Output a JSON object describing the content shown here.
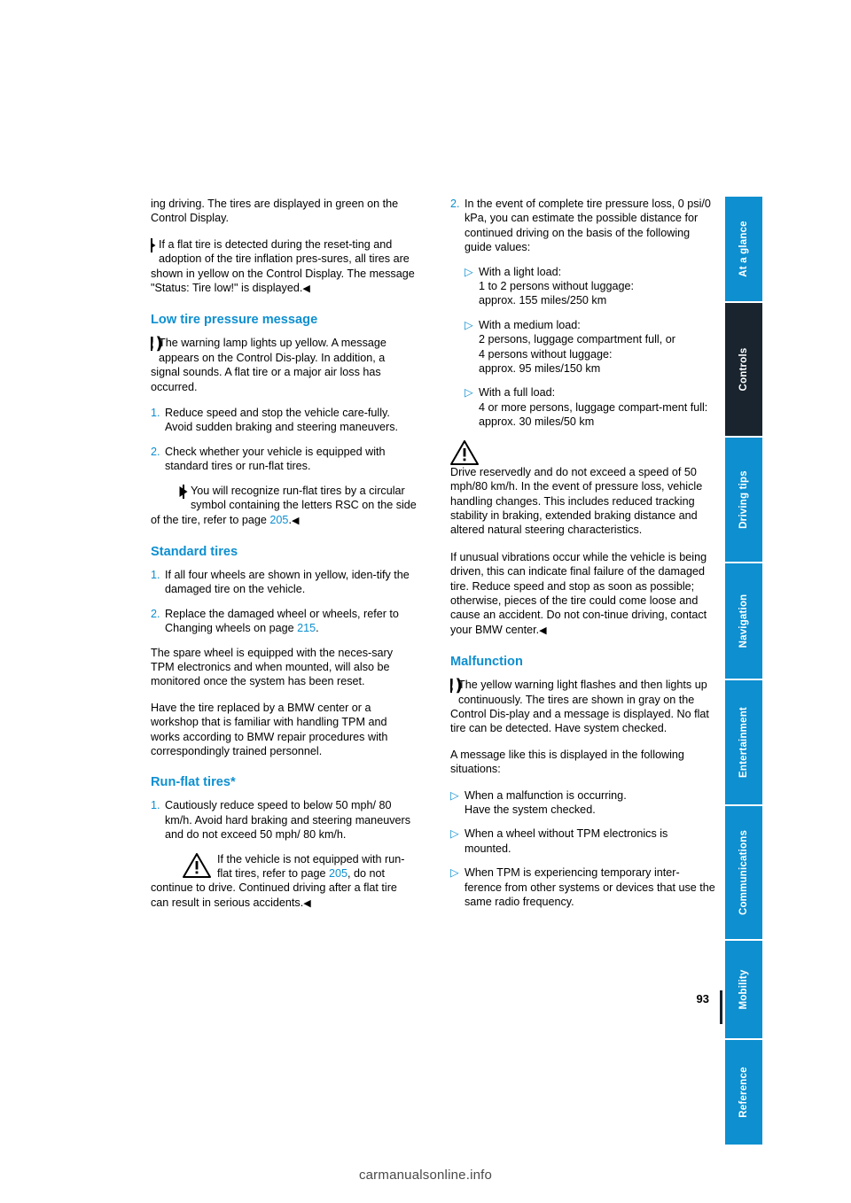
{
  "document": {
    "page_number": "93",
    "footer_brand": "carmanualsonline.info"
  },
  "tabs": [
    {
      "label": "At a glance",
      "style": "blue"
    },
    {
      "label": "Controls",
      "style": "dark"
    },
    {
      "label": "Driving tips",
      "style": "blue"
    },
    {
      "label": "Navigation",
      "style": "blue"
    },
    {
      "label": "Entertainment",
      "style": "blue"
    },
    {
      "label": "Communications",
      "style": "blue"
    },
    {
      "label": "Mobility",
      "style": "blue"
    },
    {
      "label": "Reference",
      "style": "blue"
    }
  ],
  "left_column": {
    "intro_para": "ing driving. The tires are displayed in green on the Control Display.",
    "note_reset": {
      "icon": "play-triangle-icon",
      "text_part1": "If a flat tire is detected during the reset-ting and adoption of the tire inflation pres-sures, all tires are shown in yellow on the Control Display. The message \"Status: Tire low!\" is displayed.",
      "end_mark": "◀"
    },
    "low_pressure": {
      "heading": "Low tire pressure message",
      "icon": "flat-tire-warning-icon",
      "para": "The warning lamp lights up yellow. A message appears on the Control Dis-play. In addition, a signal sounds. A flat tire or a major air loss has occurred.",
      "steps": [
        {
          "num": "1.",
          "text": "Reduce speed and stop the vehicle care-fully. Avoid sudden braking and steering maneuvers."
        },
        {
          "num": "2.",
          "text": "Check whether your vehicle is equipped with standard tires or run-flat tires."
        }
      ],
      "note_rsc": {
        "icon": "play-triangle-icon",
        "text_before": "You will recognize run-flat tires by a circular symbol containing the letters RSC on the side of the tire, refer to page ",
        "link": "205",
        "text_after": ".",
        "end_mark": "◀"
      }
    },
    "standard_tires": {
      "heading": "Standard tires",
      "steps": [
        {
          "num": "1.",
          "text": "If all four wheels are shown in yellow, iden-tify the damaged tire on the vehicle."
        },
        {
          "num": "2.",
          "text_before": "Replace the damaged wheel or wheels, refer to Changing wheels on page ",
          "link": "215",
          "text_after": "."
        }
      ],
      "para1": "The spare wheel is equipped with the neces-sary TPM electronics and when mounted, will also be monitored once the system has been reset.",
      "para2": "Have the tire replaced by a BMW center or a workshop that is familiar with handling TPM and works according to BMW repair procedures with correspondingly trained personnel."
    },
    "run_flat": {
      "heading": "Run-flat tires*",
      "steps": [
        {
          "num": "1.",
          "text": "Cautiously reduce speed to below 50 mph/ 80 km/h. Avoid hard braking and steering maneuvers and do not exceed 50 mph/ 80 km/h."
        }
      ],
      "warning": {
        "icon": "hazard-warning-icon",
        "text_before": "If the vehicle is not equipped with run-flat tires, refer to page ",
        "link": "205",
        "text_after": ", do not continue to drive. Continued driving after a flat tire can result in serious accidents.",
        "end_mark": "◀"
      }
    }
  },
  "right_column": {
    "step2": {
      "num": "2.",
      "text": "In the event of complete tire pressure loss, 0 psi/0 kPa, you can estimate the possible distance for continued driving on the basis of the following guide values:",
      "bullets": [
        {
          "bullet": "▷",
          "text": "With a light load:\n1 to 2 persons without luggage:\napprox. 155 miles/250 km"
        },
        {
          "bullet": "▷",
          "text": "With a medium load:\n2 persons, luggage compartment full, or\n4 persons without luggage:\napprox. 95 miles/150 km"
        },
        {
          "bullet": "▷",
          "text": "With a full load:\n4 or more persons, luggage compart-ment full:\napprox. 30 miles/50 km"
        }
      ]
    },
    "warning": {
      "icon": "hazard-warning-icon",
      "para1": "Drive reservedly and do not exceed a speed of 50 mph/80 km/h. In the event of pressure loss, vehicle handling changes. This includes reduced tracking stability in braking, extended braking distance and altered natural steering characteristics.",
      "para2": "If unusual vibrations occur while the vehicle is being driven, this can indicate final failure of the damaged tire. Reduce speed and stop as soon as possible; otherwise, pieces of the tire could come loose and cause an accident. Do not con-tinue driving, contact your BMW center.",
      "end_mark": "◀"
    },
    "malfunction": {
      "heading": "Malfunction",
      "icon": "flat-tire-warning-icon",
      "para1": "The yellow warning light flashes and then lights up continuously. The tires are shown in gray on the Control Dis-play and a message is displayed. No flat tire can be detected. Have system checked.",
      "para2": "A message like this is displayed in the following situations:",
      "bullets": [
        {
          "bullet": "▷",
          "text": "When a malfunction is occurring.\nHave the system checked."
        },
        {
          "bullet": "▷",
          "text": "When a wheel without TPM electronics is mounted."
        },
        {
          "bullet": "▷",
          "text": "When TPM is experiencing temporary inter-ference from other systems or devices that use the same radio frequency."
        }
      ]
    }
  },
  "colors": {
    "accent": "#0d8fd0",
    "dark_tab": "#19242e"
  }
}
